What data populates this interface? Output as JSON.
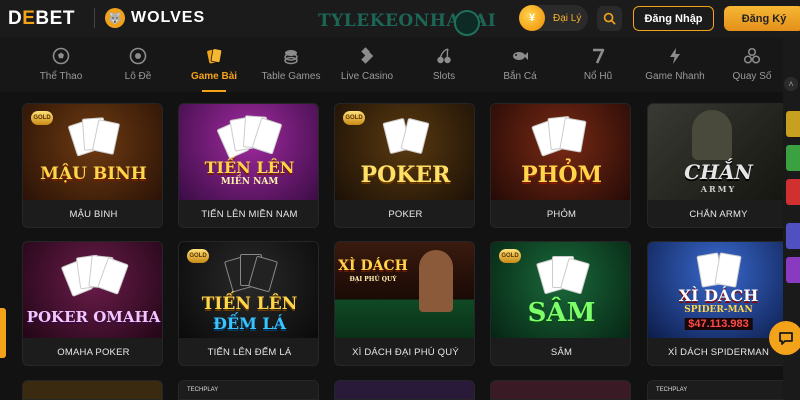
{
  "header": {
    "logo_text_a": "D",
    "logo_text_b": "E",
    "logo_text_c": "BET",
    "partner": "WOLVES",
    "watermark": "TYLEKEONHACAI",
    "agent_label": "Đại Lý",
    "login_label": "Đăng Nhập",
    "register_label": "Đăng Ký"
  },
  "nav": {
    "items": [
      {
        "label": "Thể Thao",
        "icon": "soccer-ball-icon"
      },
      {
        "label": "Lô Đề",
        "icon": "lottery-ball-icon"
      },
      {
        "label": "Game Bài",
        "icon": "playing-cards-icon",
        "active": true
      },
      {
        "label": "Table Games",
        "icon": "chips-icon"
      },
      {
        "label": "Live Casino",
        "icon": "diamond-suit-icon"
      },
      {
        "label": "Slots",
        "icon": "cherry-icon"
      },
      {
        "label": "Bắn Cá",
        "icon": "fish-icon"
      },
      {
        "label": "Nổ Hũ",
        "icon": "seven-icon"
      },
      {
        "label": "Game Nhanh",
        "icon": "lightning-icon"
      },
      {
        "label": "Quay Số",
        "icon": "balls-icon"
      }
    ]
  },
  "games": {
    "row1": [
      {
        "title": "MẬU BINH",
        "art_text": "MẬU BINH"
      },
      {
        "title": "TIẾN LÊN MIỀN NAM",
        "art_text": "TIẾN LÊN",
        "art_sub": "MIỀN NAM"
      },
      {
        "title": "POKER",
        "art_text": "POKER"
      },
      {
        "title": "PHỎM",
        "art_text": "PHỎM"
      },
      {
        "title": "CHẮN ARMY",
        "art_text": "CHẮN",
        "art_sub": "ARMY"
      }
    ],
    "row2": [
      {
        "title": "OMAHA POKER",
        "art_text": "POKER OMAHA"
      },
      {
        "title": "TIẾN LÊN ĐẾM LÁ",
        "art_text": "TIẾN LÊN",
        "art_sub": "ĐẾM LÁ"
      },
      {
        "title": "XÌ DÁCH ĐẠI PHÚ QUÝ",
        "art_text": "XÌ DÁCH",
        "art_sub": "ĐẠI PHÚ QUÝ"
      },
      {
        "title": "SÂM",
        "art_text": "SÂM"
      },
      {
        "title": "XÌ DÁCH SPIDERMAN",
        "art_text": "XÌ DÁCH",
        "art_sub": "SPIDER-MAN",
        "art_amount": "$47.113.983"
      }
    ],
    "row3_tags": [
      "",
      "TECHPLAY",
      "",
      "",
      "TECHPLAY"
    ]
  },
  "colors": {
    "accent": "#f3a31a",
    "background": "#121212"
  }
}
